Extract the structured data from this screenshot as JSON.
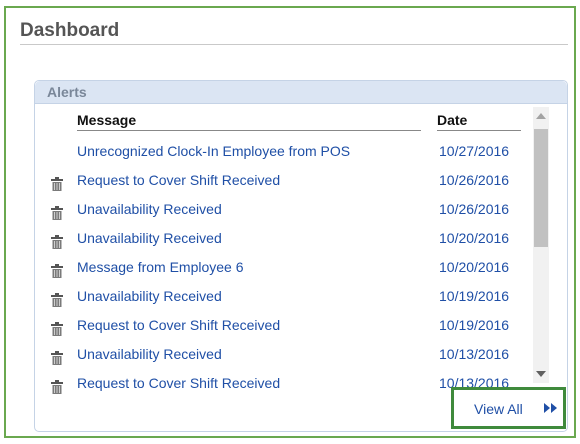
{
  "dashboard": {
    "title": "Dashboard"
  },
  "alerts": {
    "title": "Alerts",
    "columns": {
      "message": "Message",
      "date": "Date"
    },
    "rows": [
      {
        "message": "Unrecognized Clock-In Employee from POS",
        "date": "10/27/2016",
        "deletable": false
      },
      {
        "message": "Request to Cover Shift Received",
        "date": "10/26/2016",
        "deletable": true
      },
      {
        "message": "Unavailability Received",
        "date": "10/26/2016",
        "deletable": true
      },
      {
        "message": "Unavailability Received",
        "date": "10/20/2016",
        "deletable": true
      },
      {
        "message": "Message from Employee 6",
        "date": "10/20/2016",
        "deletable": true
      },
      {
        "message": "Unavailability Received",
        "date": "10/19/2016",
        "deletable": true
      },
      {
        "message": "Request to Cover Shift Received",
        "date": "10/19/2016",
        "deletable": true
      },
      {
        "message": "Unavailability Received",
        "date": "10/13/2016",
        "deletable": true
      },
      {
        "message": "Request to Cover Shift Received",
        "date": "10/13/2016",
        "deletable": true
      }
    ],
    "view_all_label": "View All",
    "view_all_icon": "double-chevron-right-icon",
    "row_icon": "trash-icon"
  },
  "colors": {
    "link": "#1f4fa6",
    "frame_border": "#6aa84f",
    "highlight_border": "#3f8a3c",
    "panel_header": "#dbe5f3"
  }
}
